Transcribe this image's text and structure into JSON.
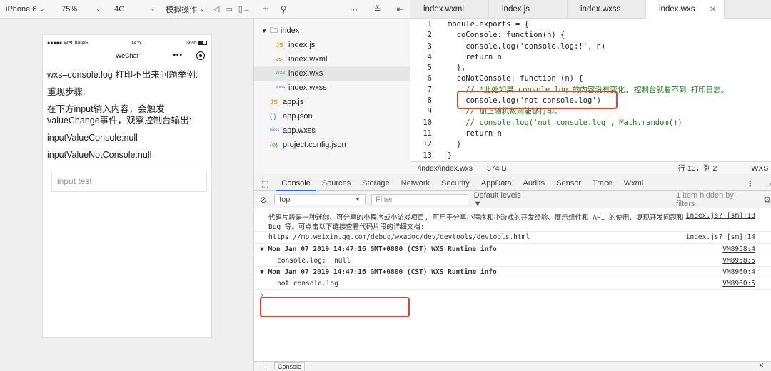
{
  "toolbar": {
    "device": "iPhone 6",
    "zoom": "75%",
    "network": "4G",
    "simulate": "模拟操作"
  },
  "phone": {
    "carrier": "●●●●● WeChat4G",
    "time": "14:50",
    "battery": "36%",
    "nav_title": "WeChat",
    "nav_more": "•••",
    "lines": [
      "wxs–console.log 打印不出来问题举例:",
      "重现步骤:",
      "在下方input输入内容，会触发valueChange事件，观察控制台输出:",
      "inputValueConsole:null",
      "inputValueNotConsole:null"
    ],
    "input_placeholder": "input test"
  },
  "file_tree": [
    {
      "name": "index",
      "icon": "folder-icon",
      "indent": 0
    },
    {
      "name": "index.js",
      "icon": "js-icon",
      "indent": 1
    },
    {
      "name": "index.wxml",
      "icon": "wxml-icon",
      "indent": 1
    },
    {
      "name": "index.wxs",
      "icon": "wxs-icon",
      "indent": 1,
      "selected": true
    },
    {
      "name": "index.wxss",
      "icon": "wxss-icon",
      "indent": 1
    },
    {
      "name": "app.js",
      "icon": "js-icon",
      "indent": 0
    },
    {
      "name": "app.json",
      "icon": "json-icon",
      "indent": 0
    },
    {
      "name": "app.wxss",
      "icon": "wxss-icon",
      "indent": 0
    },
    {
      "name": "project.config.json",
      "icon": "config-icon",
      "indent": 0
    }
  ],
  "editor_tabs": [
    "index.wxml",
    "index.js",
    "index.wxss",
    "index.wxs"
  ],
  "active_tab": "index.wxs",
  "code_lines": [
    "module.exports = {",
    "  coConsole: function(n) {",
    "    console.log('console.log:!', n)",
    "    return n",
    "  },",
    "  coNotConsole: function (n) {",
    "    // *此处如果 console.log 的内容没有变化, 控制台就看不到 打印日志。",
    "    console.log('not console.log')",
    "    // 加上随机数则能够打印。",
    "    // console.log('not console.log', Math.random())",
    "    return n",
    "  }",
    "}"
  ],
  "status": {
    "path": "/index/index.wxs",
    "size": "374 B",
    "position": "行 13，列 2",
    "lang": "WXS"
  },
  "devtools_tabs": [
    "Console",
    "Sources",
    "Storage",
    "Network",
    "Security",
    "AppData",
    "Audits",
    "Sensor",
    "Trace",
    "Wxml"
  ],
  "filter": {
    "context": "top",
    "placeholder": "Filter",
    "levels": "Default levels ▼",
    "hidden": "1 item hidden by filters"
  },
  "console": {
    "notice_1": "代码片段是一种迷你、可分享的小程序或小游戏项目, 可用于分享小程序和小游戏的开发经验、展示组件和 API 的使用、复现开发问题和",
    "notice_2": "Bug 等。可点击以下链接查看代码片段的详细文档:",
    "notice_src_1": "index.js? [sm]:13",
    "link": "https://mp.weixin.qq.com/debug/wxadoc/dev/devtools/devtools.html",
    "link_src": "index.js? [sm]:14",
    "group1": "▼ Mon Jan 07 2019 14:47:16 GMT+0800 (CST) WXS Runtime info",
    "group1_src": "VM8958:4",
    "group1_line": "console.log:! null",
    "group1_line_src": "VM8958:5",
    "group2": "▼ Mon Jan 07 2019 14:47:16 GMT+0800 (CST) WXS Runtime info",
    "group2_src": "VM8960:4",
    "group2_line": "not console.log",
    "group2_line_src": "VM8960:5",
    "prompt": "›"
  },
  "drawer_tab": "Console"
}
